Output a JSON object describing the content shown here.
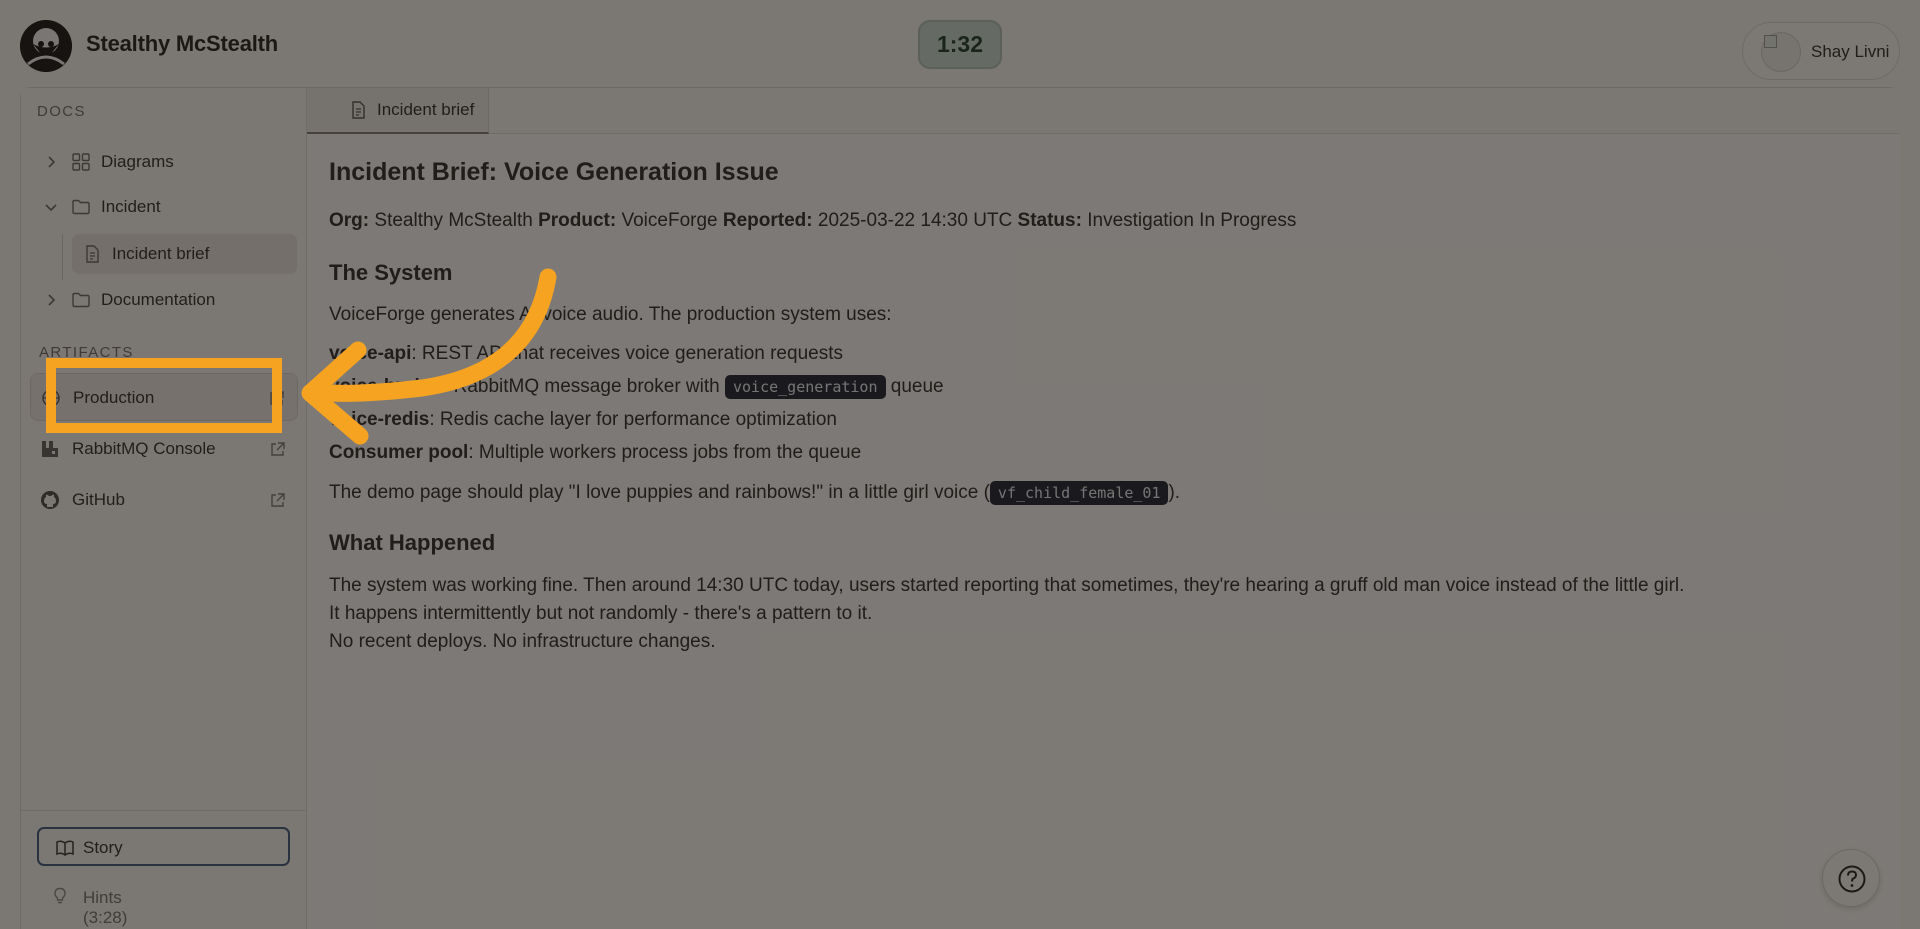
{
  "app": {
    "title": "Stealthy McStealth",
    "timer": "1:32",
    "user": "Shay Livni"
  },
  "sidebar": {
    "docs_label": "DOCS",
    "tree": [
      {
        "label": "Diagrams",
        "expanded": false,
        "icon": "grid-icon"
      },
      {
        "label": "Incident",
        "expanded": true,
        "icon": "folder-icon",
        "children": [
          {
            "label": "Incident brief",
            "icon": "document-icon",
            "selected": true
          }
        ]
      },
      {
        "label": "Documentation",
        "expanded": false,
        "icon": "folder-icon"
      }
    ],
    "artifacts_label": "ARTIFACTS",
    "artifacts": [
      {
        "label": "Production",
        "icon": "globe-icon",
        "external": true,
        "active": true
      },
      {
        "label": "RabbitMQ Console",
        "icon": "rabbitmq-icon",
        "external": true
      },
      {
        "label": "GitHub",
        "icon": "github-icon",
        "external": true
      }
    ],
    "story_label": "Story",
    "hints_label": "Hints (3:28)"
  },
  "tab": {
    "label": "Incident brief"
  },
  "doc": {
    "title": "Incident Brief: Voice Generation Issue",
    "meta": {
      "org_key": "Org:",
      "org": "Stealthy McStealth",
      "product_key": "Product:",
      "product": "VoiceForge",
      "reported_key": "Reported:",
      "reported": "2025-03-22 14:30 UTC",
      "status_key": "Status:",
      "status": "Investigation In Progress"
    },
    "system_heading": "The System",
    "system_intro": "VoiceForge generates AI voice audio. The production system uses:",
    "components": [
      {
        "name": "voice-api",
        "desc": ": REST API that receives voice generation requests"
      },
      {
        "name": "voice-broker",
        "desc": ": RabbitMQ message broker with ",
        "code": "voice_generation",
        "desc_after": " queue"
      },
      {
        "name": "voice-redis",
        "desc": ": Redis cache layer for performance optimization"
      },
      {
        "name": "Consumer pool",
        "desc": ": Multiple workers process jobs from the queue"
      }
    ],
    "demo_line_before": "The demo page should play \"I love puppies and rainbows!\" in a little girl voice (",
    "demo_code": "vf_child_female_01",
    "demo_line_after": ").",
    "happened_heading": "What Happened",
    "happened_lines": [
      "The system was working fine. Then around 14:30 UTC today, users started reporting that sometimes, they're hearing a gruff old man voice instead of the little girl.",
      "It happens intermittently but not randomly - there's a pattern to it.",
      "No recent deploys. No infrastructure changes."
    ]
  },
  "colors": {
    "highlight": "#f6a321",
    "code_bg": "#1e2533",
    "timer_bg": "#c4d8cf"
  }
}
